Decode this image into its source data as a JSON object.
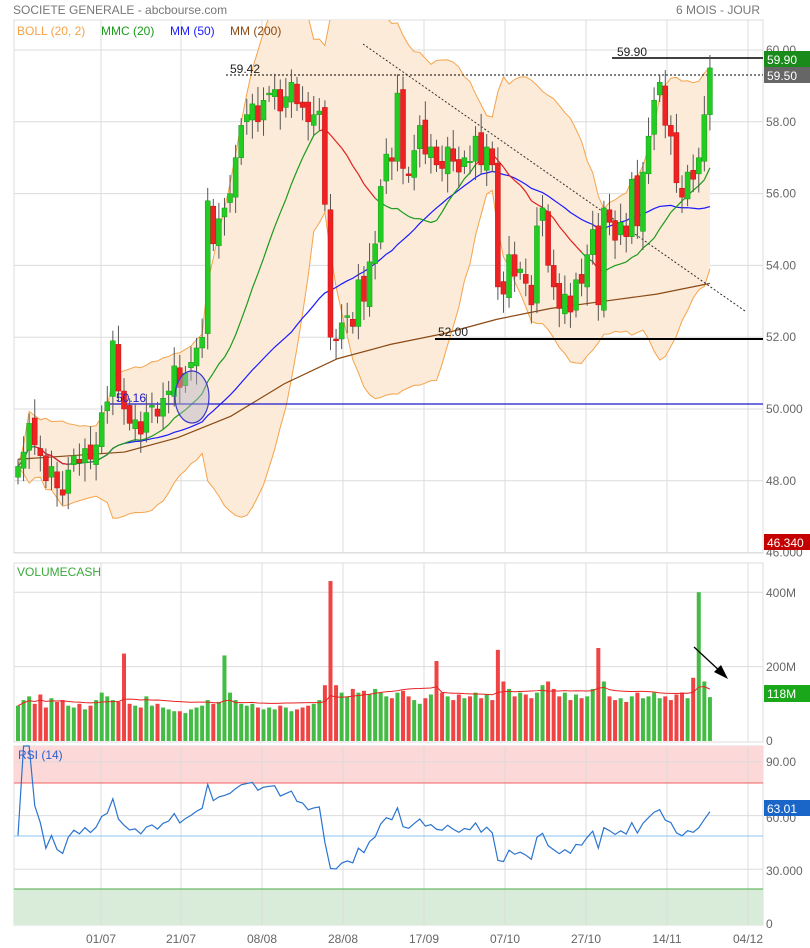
{
  "header": {
    "title": "SOCIETE GENERALE - abcbourse.com",
    "period": "6 MOIS - JOUR"
  },
  "legend": [
    {
      "label": "BOLL (20, 2)",
      "color": "#f5a34a"
    },
    {
      "label": "MMC (20)",
      "color": "#1a9a1a"
    },
    {
      "label": "MM (50)",
      "color": "#1a1aff"
    },
    {
      "label": "MM (200)",
      "color": "#8b4a14"
    }
  ],
  "colors": {
    "up": "#22cc22",
    "down": "#ee2222",
    "boll_fill": "#fcebd9",
    "boll_line": "#f5a34a",
    "rsi": "#2a74d0"
  },
  "chart_data": [
    {
      "type": "candlestick",
      "title": "SOCIETE GENERALE",
      "x_ticks": [
        "01/07",
        "21/07",
        "08/08",
        "28/08",
        "17/09",
        "07/10",
        "27/10",
        "14/11",
        "04/12"
      ],
      "y_ticks": [
        "60.00",
        "58.00",
        "56.00",
        "54.00",
        "52.00",
        "50.000",
        "48.00",
        "46.000"
      ],
      "ylim": [
        46,
        60.5
      ],
      "close": [
        48.4,
        48.8,
        49.6,
        49.0,
        48.7,
        48.0,
        48.4,
        47.8,
        47.6,
        48.3,
        48.7,
        48.5,
        48.9,
        48.6,
        49.0,
        49.9,
        50.2,
        51.9,
        50.5,
        50.0,
        49.6,
        49.7,
        49.3,
        49.9,
        50.1,
        49.8,
        50.3,
        50.5,
        51.2,
        50.6,
        51.0,
        51.3,
        51.7,
        52.0,
        55.8,
        54.6,
        55.3,
        55.6,
        56.0,
        57.0,
        57.9,
        58.2,
        58.5,
        58.0,
        58.6,
        58.8,
        58.9,
        58.3,
        58.7,
        59.1,
        58.5,
        58.4,
        58.0,
        58.2,
        58.3,
        55.7,
        52.0,
        51.9,
        52.4,
        52.6,
        52.3,
        53.6,
        53.0,
        54.1,
        54.6,
        56.2,
        57.1,
        56.9,
        58.8,
        56.7,
        56.5,
        57.2,
        57.9,
        57.1,
        57.3,
        56.8,
        56.7,
        57.3,
        56.9,
        56.6,
        57.0,
        56.9,
        57.6,
        56.8,
        57.3,
        56.8,
        53.4,
        53.2,
        54.3,
        53.7,
        53.9,
        53.5,
        52.9,
        55.1,
        55.6,
        54.0,
        53.4,
        52.8,
        53.2,
        52.7,
        53.6,
        53.5,
        54.3,
        55.0,
        52.9,
        55.6,
        55.2,
        54.7,
        55.2,
        54.8,
        56.4,
        55.1,
        56.6,
        57.6,
        58.6,
        59.1,
        57.9,
        57.6,
        56.3,
        55.9,
        56.6,
        56.4,
        57.0,
        58.2,
        59.5
      ],
      "mm200": [
        48.6,
        48.7,
        48.8,
        49.2,
        49.8,
        50.7,
        51.4,
        51.8,
        52.1,
        52.5,
        52.8,
        53.0,
        53.2,
        53.5
      ],
      "annotations": {
        "resistance_high": {
          "label": "59.90",
          "value": 59.9
        },
        "resistance_dotted": {
          "label": "59.42",
          "value": 59.42
        },
        "support": {
          "label": "52.00",
          "value": 52.0
        },
        "support_blue": {
          "label": "50.16",
          "value": 50.16
        }
      },
      "tags": {
        "high": "59.90",
        "last": "59.50",
        "low": "46.340"
      }
    },
    {
      "type": "bar",
      "title": "VOLUMECASH",
      "y_ticks": [
        "400M",
        "200M",
        "0"
      ],
      "ylim": [
        0,
        450
      ],
      "unit": "M",
      "values": [
        95,
        110,
        120,
        100,
        125,
        90,
        115,
        105,
        110,
        95,
        90,
        100,
        85,
        95,
        110,
        130,
        120,
        110,
        105,
        235,
        100,
        95,
        90,
        120,
        95,
        100,
        90,
        85,
        80,
        80,
        75,
        85,
        90,
        95,
        110,
        100,
        105,
        230,
        130,
        110,
        100,
        95,
        100,
        90,
        85,
        90,
        85,
        95,
        90,
        80,
        85,
        90,
        95,
        100,
        110,
        150,
        430,
        150,
        130,
        120,
        140,
        130,
        135,
        125,
        140,
        130,
        120,
        115,
        130,
        135,
        120,
        110,
        100,
        115,
        125,
        215,
        130,
        120,
        110,
        125,
        115,
        120,
        130,
        115,
        125,
        110,
        245,
        160,
        140,
        120,
        130,
        125,
        115,
        130,
        150,
        160,
        140,
        120,
        130,
        110,
        125,
        115,
        120,
        140,
        250,
        160,
        120,
        110,
        115,
        105,
        120,
        130,
        115,
        120,
        130,
        115,
        120,
        110,
        125,
        130,
        115,
        170,
        400,
        160,
        118
      ],
      "tag": "118M"
    },
    {
      "type": "line",
      "title": "RSI (14)",
      "y_ticks": [
        "90.00",
        "60.00",
        "30.000",
        "0"
      ],
      "ylim": [
        0,
        100
      ],
      "levels": [
        80,
        50,
        20
      ],
      "tag": "63.01"
    }
  ]
}
